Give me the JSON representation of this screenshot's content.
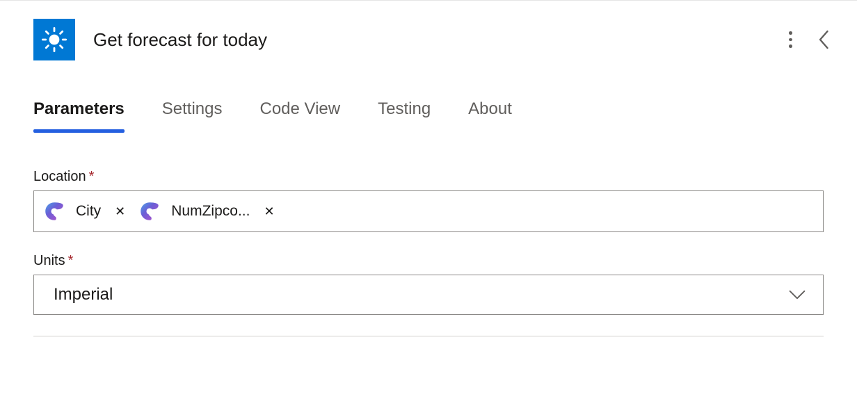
{
  "header": {
    "title": "Get forecast for today",
    "icon_name": "sun-icon"
  },
  "tabs": [
    {
      "label": "Parameters",
      "active": true
    },
    {
      "label": "Settings",
      "active": false
    },
    {
      "label": "Code View",
      "active": false
    },
    {
      "label": "Testing",
      "active": false
    },
    {
      "label": "About",
      "active": false
    }
  ],
  "fields": {
    "location": {
      "label": "Location",
      "required_mark": "*",
      "tokens": [
        {
          "label": "City",
          "remove": "✕"
        },
        {
          "label": "NumZipco...",
          "remove": "✕"
        }
      ]
    },
    "units": {
      "label": "Units",
      "required_mark": "*",
      "value": "Imperial"
    }
  }
}
